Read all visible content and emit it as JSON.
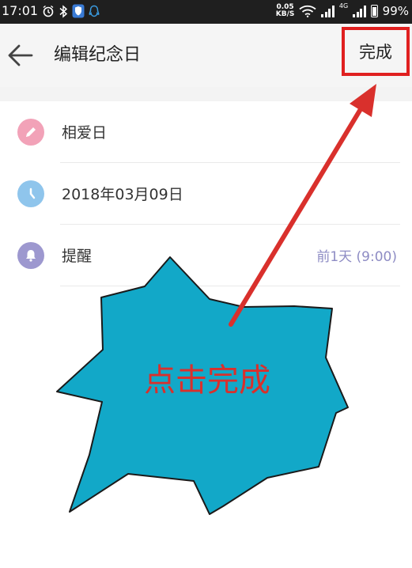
{
  "status_bar": {
    "time": "17:01",
    "speed_value": "0.05",
    "speed_unit": "KB/S",
    "network": "4G",
    "battery": "99%"
  },
  "toolbar": {
    "title": "编辑纪念日",
    "done_label": "完成"
  },
  "form": {
    "rows": [
      {
        "label": "相爱日",
        "icon": "pencil-icon",
        "icon_color": "#f2a2b8"
      },
      {
        "label": "2018年03月09日",
        "icon": "clock-icon",
        "icon_color": "#8fc5ec"
      },
      {
        "label": "提醒",
        "icon": "bell-icon",
        "icon_color": "#9d98cf",
        "value": "前1天 (9:00)"
      }
    ]
  },
  "annotation": {
    "text": "点击完成",
    "burst_color": "#12a8c8",
    "arrow_color": "#d9302c",
    "highlight_color": "#e02020"
  }
}
